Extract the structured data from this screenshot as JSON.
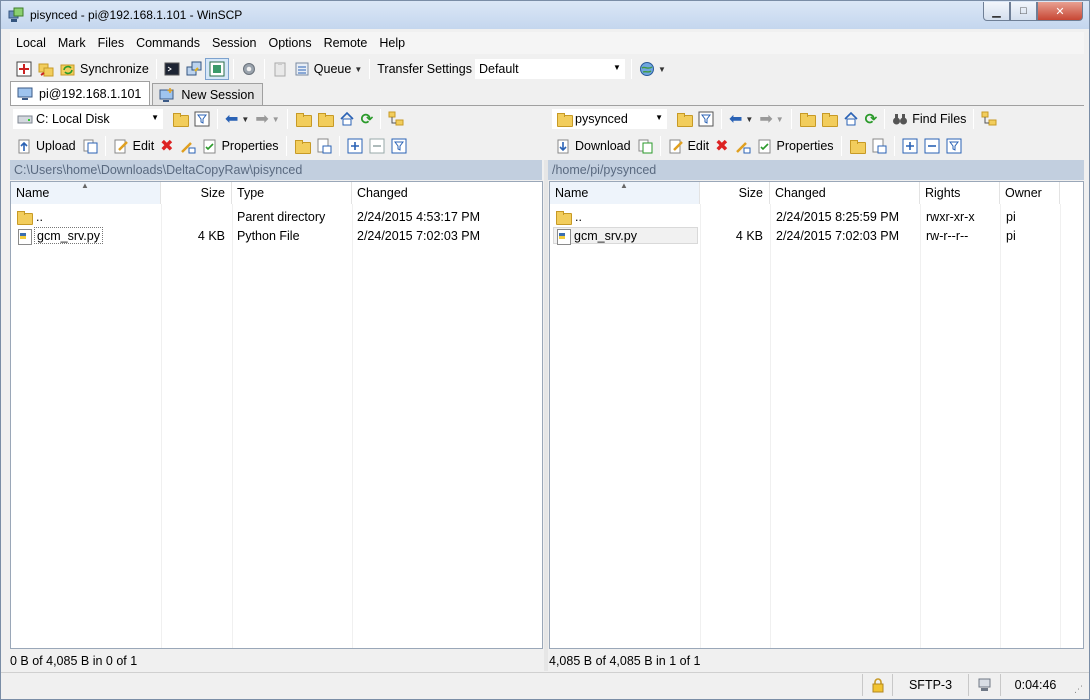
{
  "window": {
    "title": "pisynced - pi@192.168.1.101 - WinSCP",
    "min_glyph": "▁",
    "max_glyph": "□",
    "close_glyph": "✕"
  },
  "menu": [
    "Local",
    "Mark",
    "Files",
    "Commands",
    "Session",
    "Options",
    "Remote",
    "Help"
  ],
  "toolbar": {
    "synchronize": "Synchronize",
    "queue": "Queue",
    "transfer_settings": "Transfer Settings",
    "transfer_preset": "Default"
  },
  "tabs": [
    {
      "label": "pi@192.168.1.101",
      "icon": "monitor-icon",
      "active": true
    },
    {
      "label": "New Session",
      "icon": "new-session-icon",
      "active": false
    }
  ],
  "local": {
    "drive": "C: Local Disk",
    "upload": "Upload",
    "edit": "Edit",
    "properties": "Properties",
    "path": "C:\\Users\\home\\Downloads\\DeltaCopyRaw\\pisynced",
    "columns": {
      "name": "Name",
      "size": "Size",
      "type": "Type",
      "changed": "Changed"
    },
    "files": [
      {
        "name": "..",
        "size": "",
        "type": "Parent directory",
        "changed": "2/24/2015  4:53:17 PM",
        "icon": "parent-folder-icon"
      },
      {
        "name": "gcm_srv.py",
        "size": "4 KB",
        "type": "Python File",
        "changed": "2/24/2015  7:02:03 PM",
        "icon": "python-file-icon"
      }
    ],
    "status": "0 B of 4,085 B in 0 of 1"
  },
  "remote": {
    "folder": "pysynced",
    "download": "Download",
    "edit": "Edit",
    "properties": "Properties",
    "find_files": "Find Files",
    "path": "/home/pi/pysynced",
    "columns": {
      "name": "Name",
      "size": "Size",
      "changed": "Changed",
      "rights": "Rights",
      "owner": "Owner"
    },
    "files": [
      {
        "name": "..",
        "size": "",
        "changed": "2/24/2015 8:25:59 PM",
        "rights": "rwxr-xr-x",
        "owner": "pi",
        "icon": "parent-folder-icon"
      },
      {
        "name": "gcm_srv.py",
        "size": "4 KB",
        "changed": "2/24/2015  7:02:03 PM",
        "rights": "rw-r--r--",
        "owner": "pi",
        "icon": "python-file-icon"
      }
    ],
    "status": "4,085 B of 4,085 B in 1 of 1"
  },
  "statusbar": {
    "protocol": "SFTP-3",
    "elapsed": "0:04:46"
  }
}
